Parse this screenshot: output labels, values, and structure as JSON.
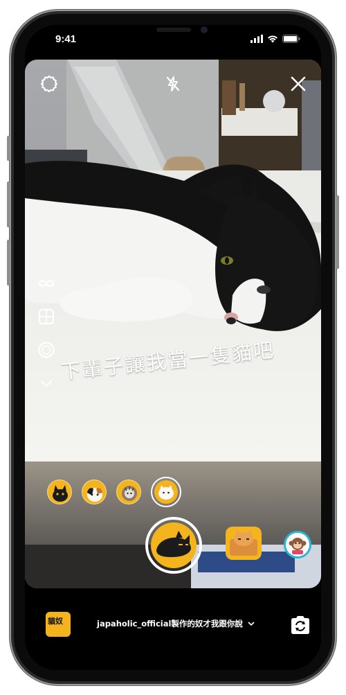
{
  "status_bar": {
    "time": "9:41"
  },
  "camera": {
    "top_controls": [
      "settings-icon",
      "flash-off-icon",
      "close-icon"
    ],
    "side_tools": [
      "boomerang-icon",
      "layout-icon",
      "hands-free-icon",
      "chevron-down-icon"
    ]
  },
  "caption": {
    "text": "下輩子讓我當一隻貓吧"
  },
  "filters": {
    "count": 4,
    "selected_index": 3
  },
  "effect": {
    "thumb_label": "貓奴",
    "credit": "japaholic_official製作的奴才我跟你說"
  },
  "colors": {
    "accent_yellow": "#f4b41e",
    "table_white": "#f1f1ef",
    "wall_gray": "#9b9da0"
  }
}
